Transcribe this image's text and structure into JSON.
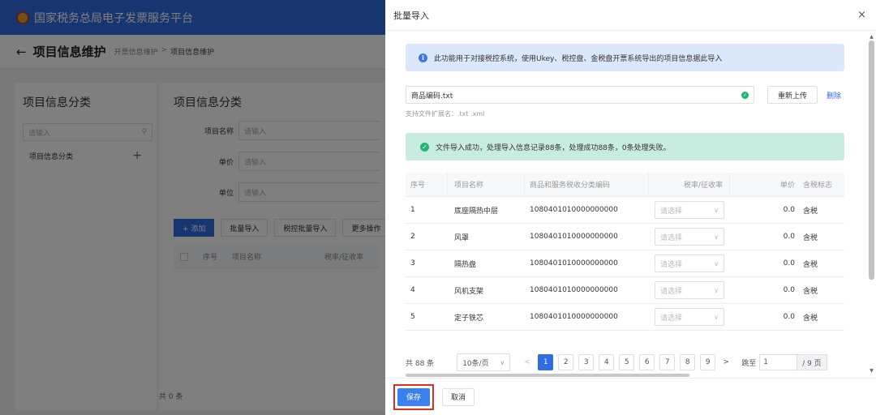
{
  "app": {
    "title": "国家税务总局电子发票服务平台",
    "page_title": "项目信息维护",
    "back_icon": "left-arrow-icon",
    "breadcrumb": [
      "开票信息维护",
      ">",
      "项目信息维护"
    ]
  },
  "left_panel": {
    "title": "项目信息分类",
    "search_placeholder": "请输入",
    "tree_item": "项目信息分类"
  },
  "main_panel": {
    "title": "项目信息分类",
    "fields": [
      {
        "label": "项目名称",
        "placeholder": "请输入"
      },
      {
        "label": "单价",
        "placeholder": "请输入"
      },
      {
        "label": "单位",
        "placeholder": "请输入"
      }
    ],
    "actions": [
      "+ 添加",
      "批量导入",
      "税控批量导入",
      "更多操作"
    ],
    "table_headers": [
      "序号",
      "项目名称",
      "税率/征收率"
    ],
    "total": "共 0 条"
  },
  "drawer": {
    "title": "批量导入",
    "close_icon": "close-icon",
    "info_text": "此功能用于对接税控系统，使用Ukey、税控盘、金税盘开票系统导出的项目信息据此导入",
    "file_name": "商品编码.txt",
    "reupload_label": "重新上传",
    "delete_label": "删除",
    "ext_hint": "支持文件扩展名：.txt .xml",
    "success_text": "文件导入成功，处理导入信息记录88条，处理成功88条，0条处理失败。",
    "table": {
      "headers": [
        "序号",
        "项目名称",
        "商品和服务税收分类编码",
        "税率/征收率",
        "单价",
        "含税标志"
      ],
      "rows": [
        {
          "no": "1",
          "name": "底座隔热中层",
          "code": "1080401010000000000",
          "rate": "请选择",
          "price": "0.0",
          "tax": "含税"
        },
        {
          "no": "2",
          "name": "风罩",
          "code": "1080401010000000000",
          "rate": "请选择",
          "price": "0.0",
          "tax": "含税"
        },
        {
          "no": "3",
          "name": "隔热盘",
          "code": "1080401010000000000",
          "rate": "请选择",
          "price": "0.0",
          "tax": "含税"
        },
        {
          "no": "4",
          "name": "风机支架",
          "code": "1080401010000000000",
          "rate": "请选择",
          "price": "0.0",
          "tax": "含税"
        },
        {
          "no": "5",
          "name": "定子铁芯",
          "code": "1080401010000000000",
          "rate": "请选择",
          "price": "0.0",
          "tax": "含税"
        }
      ]
    },
    "pagination": {
      "total": "共 88 条",
      "page_size": "10条/页",
      "prev": "<",
      "pages": [
        "1",
        "2",
        "3",
        "4",
        "5",
        "6",
        "7",
        "8",
        "9"
      ],
      "current_page": "1",
      "next": ">",
      "jump_label": "跳至",
      "jump_value": "1",
      "page_total": "/ 9 页"
    },
    "save_label": "保存",
    "cancel_label": "取消"
  },
  "colors": {
    "primary": "#2f6de1",
    "success": "#22b573",
    "highlight_border": "#d93025"
  }
}
